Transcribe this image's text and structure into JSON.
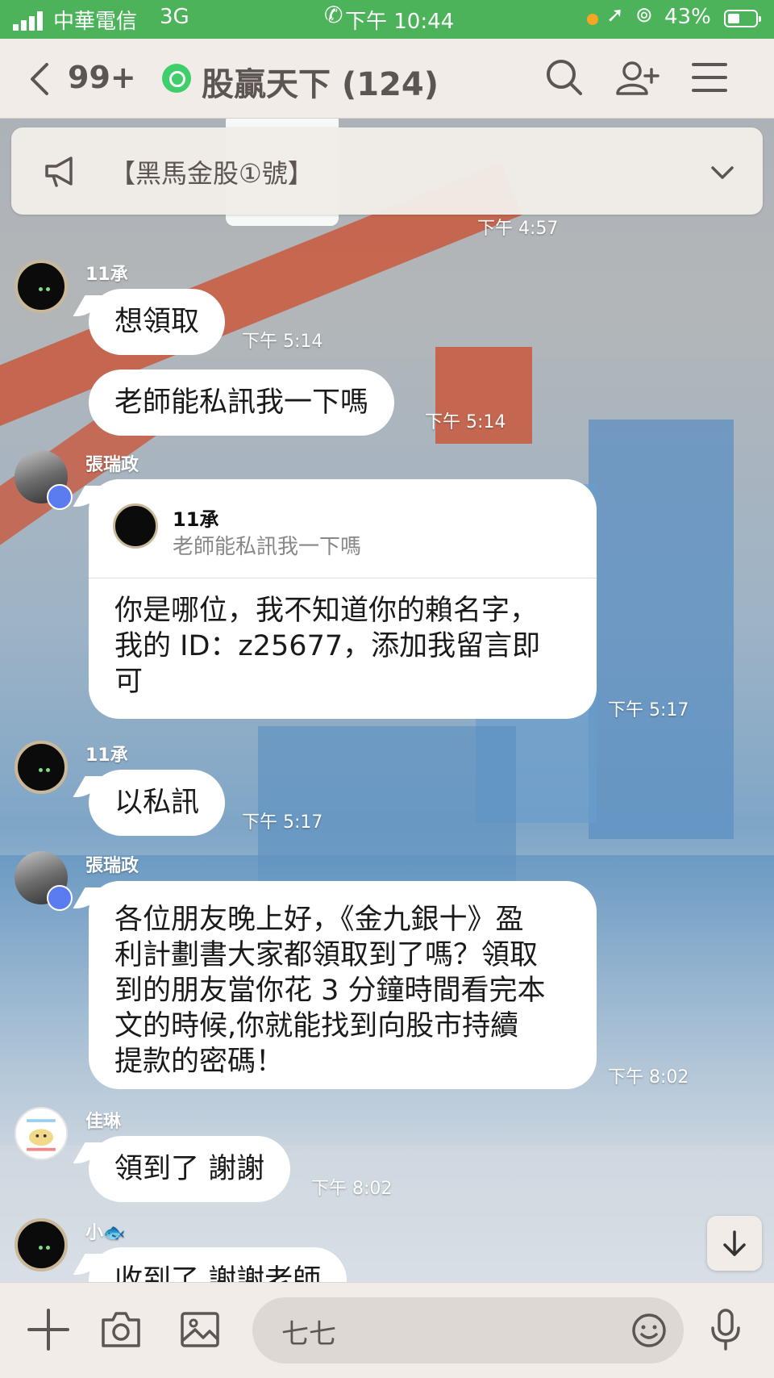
{
  "status_bar": {
    "carrier": "中華電信",
    "network": "3G",
    "time": "下午 10:44",
    "battery": "43%",
    "battery_level": 0.43
  },
  "header": {
    "unread_count": "99+",
    "chat_title": "股贏天下 (124)"
  },
  "announcement": {
    "text": "【黑馬金股①號】"
  },
  "messages": [
    {
      "time": "下午 4:57"
    },
    {
      "sender": "11承",
      "text": "想領取",
      "time": "下午 5:14"
    },
    {
      "text": "老師能私訊我一下嗎",
      "time": "下午 5:14"
    },
    {
      "sender": "張瑞政",
      "reply_to_name": "11承",
      "reply_to_text": "老師能私訊我一下嗎",
      "lines": [
        "你是哪位，我不知道你的賴名字，",
        "我的 ID：z25677，添加我留言即",
        "可"
      ],
      "time": "下午 5:17"
    },
    {
      "sender": "11承",
      "text": "以私訊",
      "time": "下午 5:17"
    },
    {
      "sender": "張瑞政",
      "lines": [
        "各位朋友晚上好，《金九銀十》盈",
        "利計劃書大家都領取到了嗎？領取",
        "到的朋友當你花 3 分鐘時間看完本",
        "文的時候,你就能找到向股市持續",
        "提款的密碼！"
      ],
      "time": "下午 8:02"
    },
    {
      "sender": "佳琳",
      "text": "領到了 謝謝",
      "time": "下午 8:02"
    },
    {
      "sender": "小🐟",
      "text": "收到了 謝謝老師"
    }
  ],
  "input": {
    "value": "七七"
  },
  "colors": {
    "status_bar": "#4cb35b",
    "header_bg": "#f1ece8",
    "bubble": "#ffffff",
    "admin_crown": "#5b7bf0"
  },
  "icons": [
    "back-chevron-icon",
    "search-icon",
    "add-friend-icon",
    "menu-icon",
    "megaphone-icon",
    "chevron-down-icon",
    "arrow-down-icon",
    "plus-icon",
    "camera-icon",
    "image-icon",
    "emoji-icon",
    "microphone-icon"
  ]
}
